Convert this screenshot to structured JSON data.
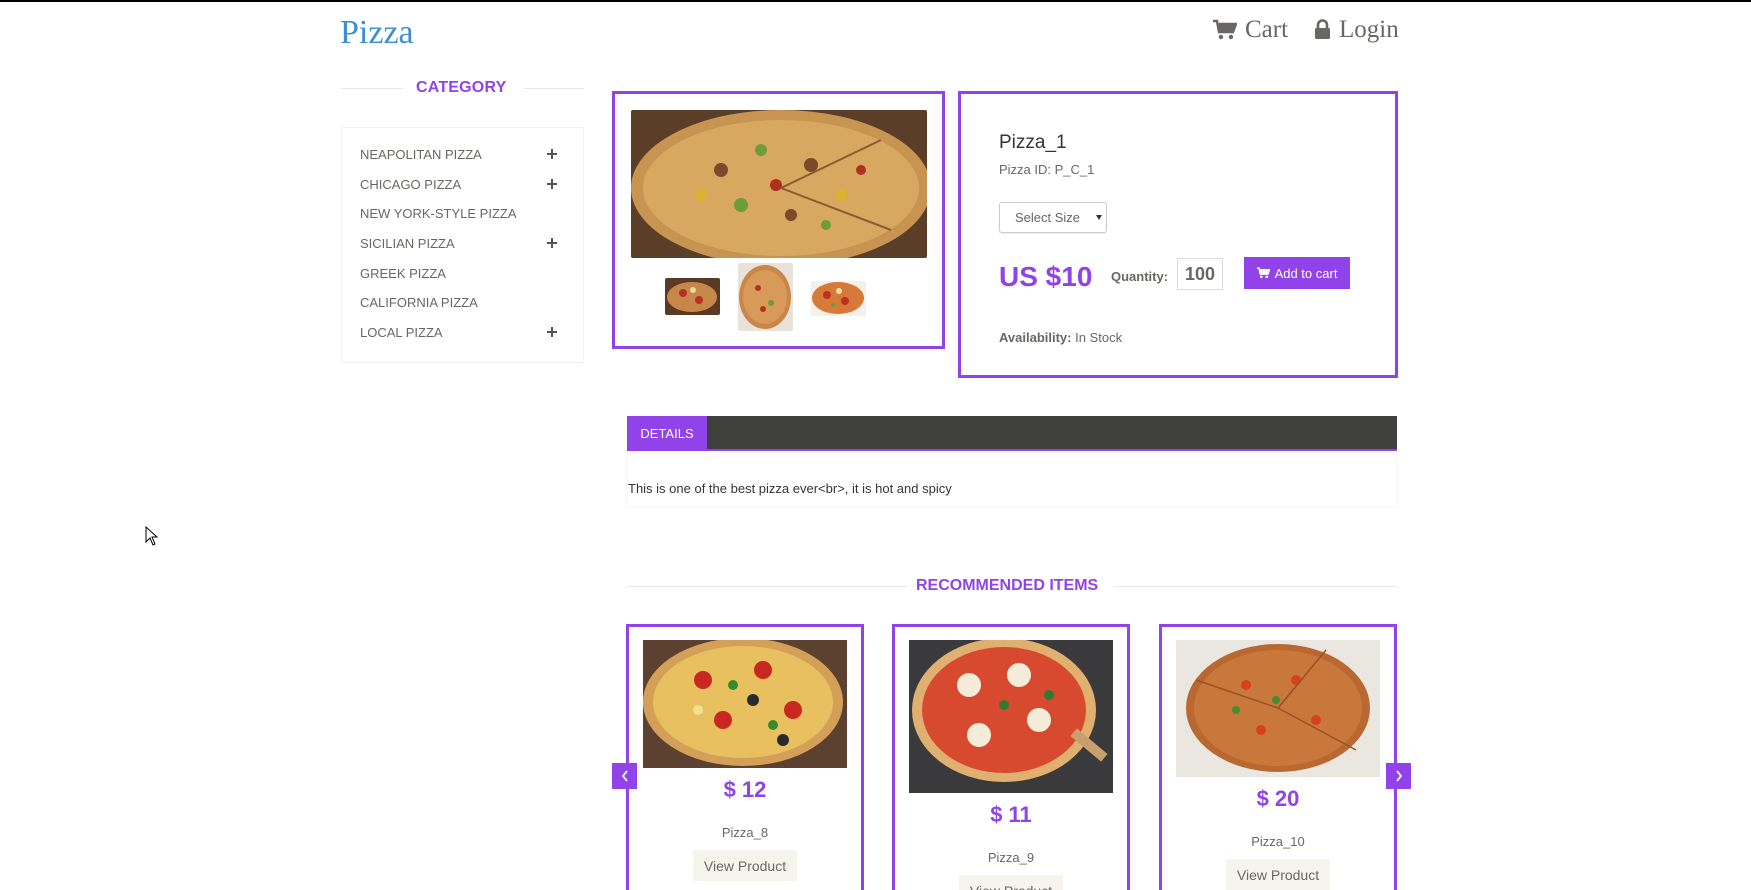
{
  "header": {
    "brand": "Pizza",
    "cart_label": "Cart",
    "login_label": "Login"
  },
  "sidebar": {
    "title": "CATEGORY",
    "items": [
      {
        "label": "NEAPOLITAN PIZZA",
        "expandable": true
      },
      {
        "label": "CHICAGO PIZZA",
        "expandable": true
      },
      {
        "label": "NEW YORK-STYLE PIZZA",
        "expandable": false
      },
      {
        "label": "SICILIAN PIZZA",
        "expandable": true
      },
      {
        "label": "GREEK PIZZA",
        "expandable": false
      },
      {
        "label": "CALIFORNIA PIZZA",
        "expandable": false
      },
      {
        "label": "LOCAL PIZZA",
        "expandable": true
      }
    ]
  },
  "product": {
    "name": "Pizza_1",
    "id_text": "Pizza ID: P_C_1",
    "size_placeholder": "Select Size",
    "price": "US $10",
    "quantity_label": "Quantity:",
    "quantity_value": "100",
    "add_to_cart": "Add to cart",
    "availability_label": "Availability:",
    "availability_value": "In Stock"
  },
  "details": {
    "tab_label": "DETAILS",
    "text": "This is one of the best pizza ever<br>, it is hot and spicy"
  },
  "recommended": {
    "title": "RECOMMENDED ITEMS",
    "items": [
      {
        "price": "$ 12",
        "name": "Pizza_8",
        "button": "View Product"
      },
      {
        "price": "$ 11",
        "name": "Pizza_9",
        "button": "View Product"
      },
      {
        "price": "$ 20",
        "name": "Pizza_10",
        "button": "View Product"
      }
    ]
  },
  "colors": {
    "accent": "#9142e8",
    "brand": "#3d8fd1",
    "tab_bar": "#40403e"
  }
}
